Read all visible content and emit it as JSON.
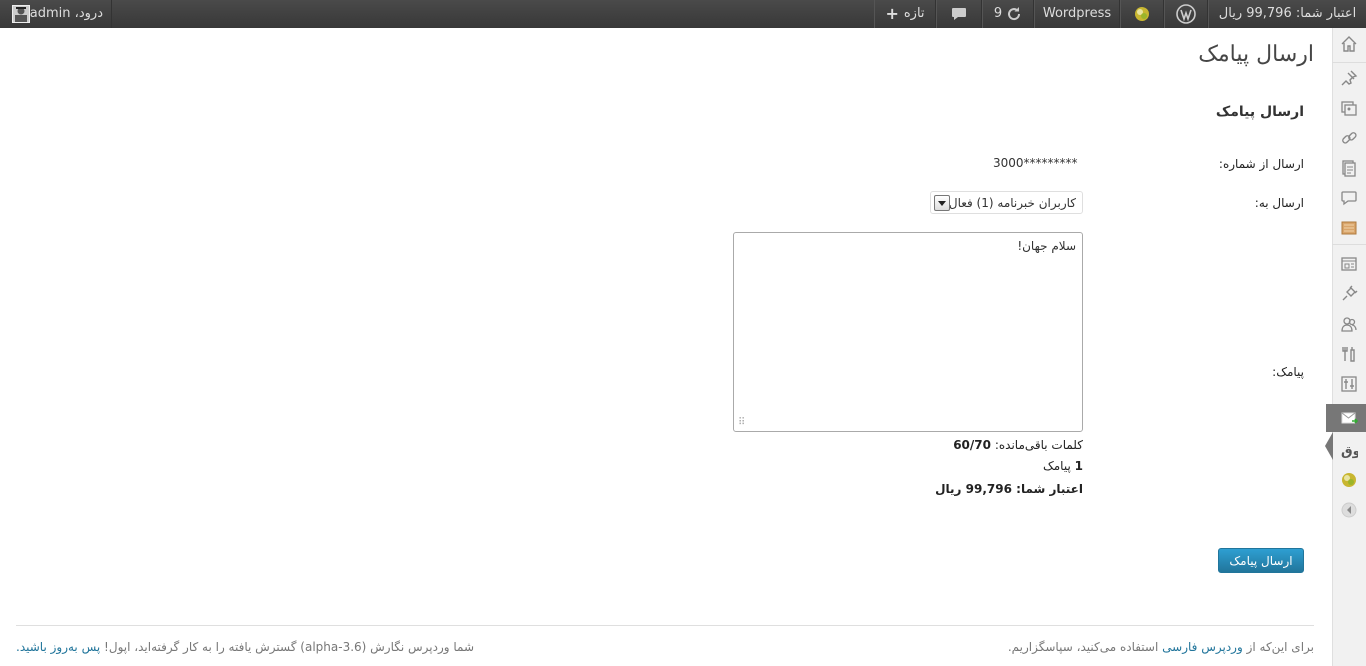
{
  "adminbar": {
    "credit_label": "اعتبار شما: 99,796 ریال",
    "site_name": "Wordpress",
    "updates_count": "9",
    "new_label": "تازه",
    "greeting": "درود، admin",
    "icons": [
      "wordpress-logo-icon",
      "status-ball-icon",
      "refresh-icon",
      "comment-bubble-icon",
      "plus-icon",
      "avatar-icon"
    ]
  },
  "page": {
    "title": "ارسال پیامک",
    "section_title": "ارسال پیامک"
  },
  "form": {
    "from_label": "ارسال از شماره:",
    "from_value": "3000*********",
    "to_label": "ارسال به:",
    "to_selected": "کاربران خبرنامه (1) فعال",
    "message_label": "پیامک:",
    "message_value": "سلام جهان!",
    "remaining_label": "کلمات باقی‌مانده:",
    "remaining_value": "60/70",
    "sms_count_num": "1",
    "sms_count_label": "پیامک",
    "credit_label": "اعتبار شما:",
    "credit_value": "99,796",
    "credit_unit": "ریال",
    "submit_label": "ارسال پیامک"
  },
  "footer": {
    "right_prefix": "برای این‌که از",
    "right_link": "وردپرس فارسی",
    "right_suffix": "استفاده می‌کنید، سپاسگزاریم.",
    "left_prefix": "شما وردپرس نگارش (alpha-3.6) گسترش یافته را به کار گرفته‌اید، اپول!",
    "left_link": "پس به‌روز باشید."
  },
  "sidebar": {
    "icons": [
      "dashboard-icon",
      "posts-pin-icon",
      "media-icon",
      "links-icon",
      "pages-icon",
      "comments-icon",
      "feedback-icon",
      "appearance-icon",
      "plugins-icon",
      "users-icon",
      "tools-icon",
      "settings-icon",
      "sms-icon",
      "custom-plugin-icon",
      "status-icon",
      "collapse-icon"
    ]
  },
  "colors": {
    "adminbar_bg": "#464646",
    "link": "#21759b",
    "button": "#21759b"
  }
}
